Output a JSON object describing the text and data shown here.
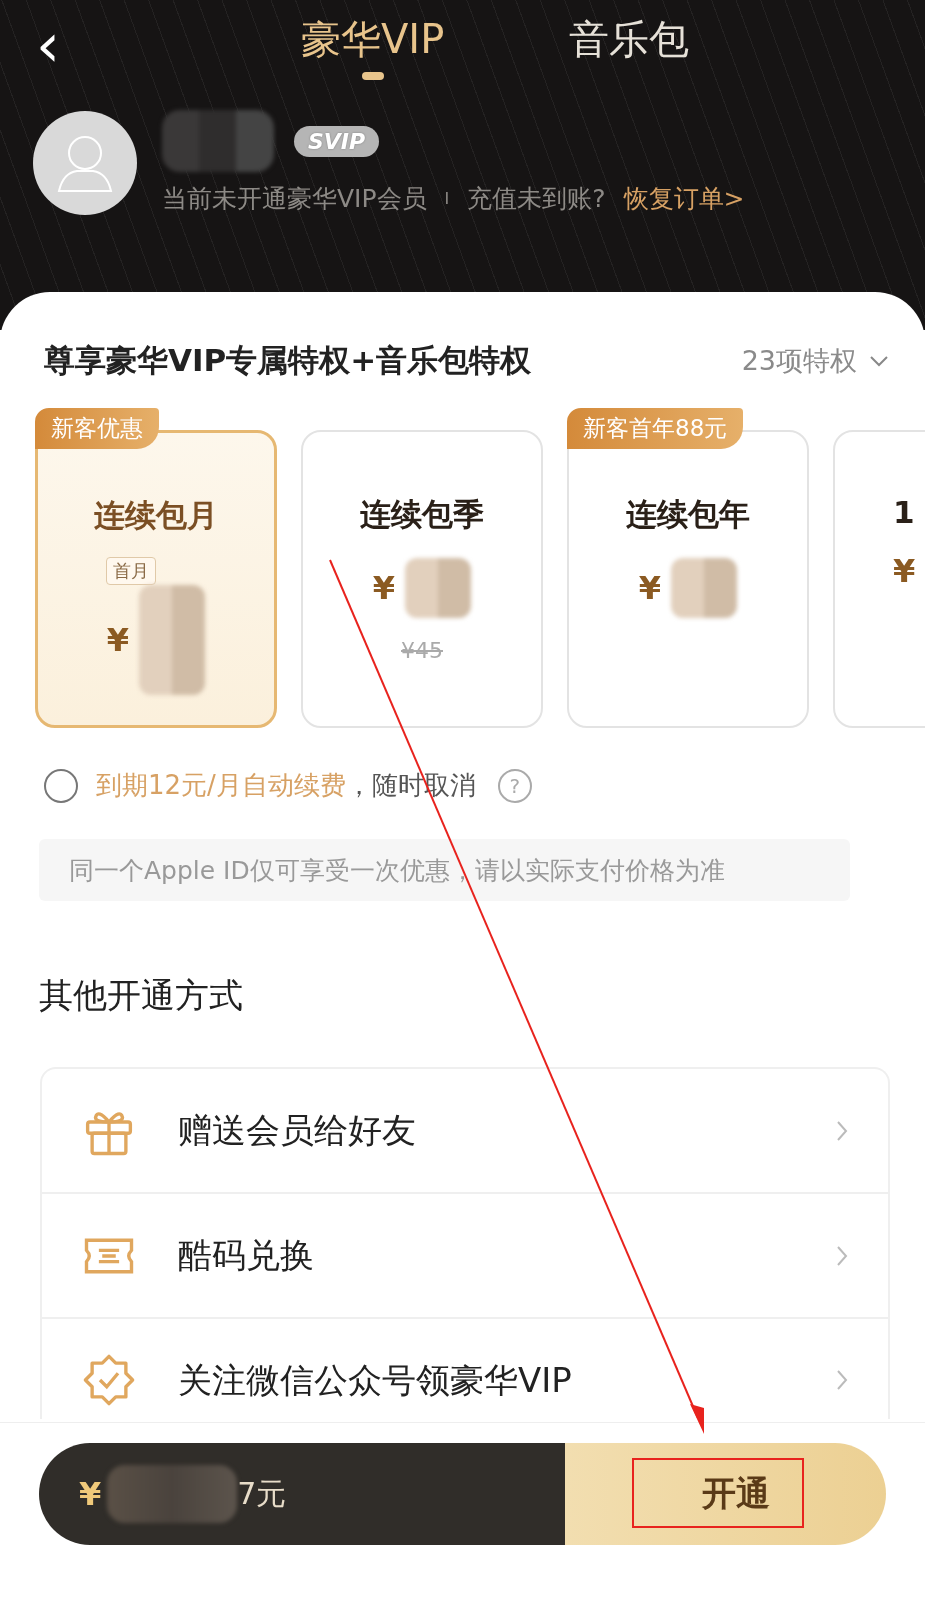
{
  "header": {
    "back": "‹",
    "tabs": [
      {
        "label": "豪华VIP",
        "selected": true
      },
      {
        "label": "音乐包",
        "selected": false
      }
    ]
  },
  "profile": {
    "badge": "SVIP",
    "status": "当前未开通豪华VIP会员",
    "separator": "I",
    "question": "充值未到账?",
    "link": "恢复订单>"
  },
  "privileges": {
    "title": "尊享豪华VIP专属特权+音乐包特权",
    "count": "23项特权"
  },
  "plans": [
    {
      "title": "连续包月",
      "badge": "新客优惠",
      "note": "首月",
      "currency": "¥",
      "selected": true
    },
    {
      "title": "连续包季",
      "currency": "¥",
      "original_price": "¥45",
      "selected": false
    },
    {
      "title": "连续包年",
      "badge": "新客首年88元",
      "currency": "¥",
      "selected": false
    },
    {
      "title": "1",
      "currency": "¥",
      "selected": false
    }
  ],
  "renewal": {
    "checked": false,
    "highlight": "到期12元/月自动续费",
    "rest": "，随时取消",
    "help": "?"
  },
  "notice": "同一个Apple ID仅可享受一次优惠，请以实际支付价格为准",
  "other": {
    "title": "其他开通方式",
    "items": [
      {
        "kind": "gift",
        "label": "赠送会员给好友"
      },
      {
        "kind": "ticket",
        "label": "酷码兑换"
      },
      {
        "kind": "badge",
        "label": "关注微信公众号领豪华VIP"
      }
    ]
  },
  "checkout": {
    "currency": "¥",
    "amount": "7元",
    "button": "开通"
  },
  "annotations": {
    "arrow": true,
    "highlight_box": true
  }
}
